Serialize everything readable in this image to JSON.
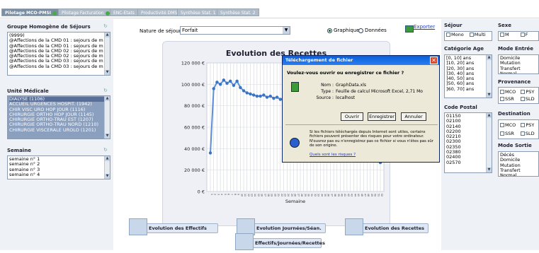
{
  "tabs": [
    {
      "label": "Pilotage MCO-PMSI",
      "active": true,
      "dot": true
    },
    {
      "label": "Pilotage Facturation",
      "active": false,
      "dot": true
    },
    {
      "label": "ENC-Etats",
      "active": false,
      "dot": false
    },
    {
      "label": "Productivité DMS",
      "active": false,
      "dot": false
    },
    {
      "label": "Synthèse Stat. 1",
      "active": false,
      "dot": false
    },
    {
      "label": "Synthèse Stat. 2",
      "active": false,
      "dot": false
    }
  ],
  "ghs": {
    "title": "Groupe Homogène de Séjours",
    "items": [
      "(9999)",
      "@Affections de la CMD 01 : sejours de m",
      "@Affections de la CMD 01 : sejours de m",
      "@Affections de la CMD 02 : sejours de m",
      "@Affections de la CMD 02 : sejours de m",
      "@Affections de la CMD 03 : sejours de m",
      "@Affections de la CMD 03 : sejours de m"
    ]
  },
  "unite": {
    "title": "Unité Médicale",
    "items": [
      "DIALYSE (1106)",
      "ACCUEIL URGENCES HOSPIT. (1942)",
      "CHIR VISC URO HOP JOUR (1116)",
      "CHIRURGIE ORTHO HOP JOUR (1145)",
      "CHIRURGIE ORTHO-TRAU EST (1207)",
      "CHIRURGIE ORTHO-TRAU NORD (1210)",
      "CHIRURGIE VISCERALE UROLO (1201)"
    ]
  },
  "semaine": {
    "title": "Semaine",
    "items": [
      "semaine n° 1",
      "semaine n° 2",
      "semaine n° 3",
      "semaine n° 4"
    ]
  },
  "controls": {
    "nature_label": "Nature de séjour :",
    "nature_value": "Forfait",
    "radio_graph": "Graphique",
    "radio_data": "Données",
    "export": "Exporter"
  },
  "chart_data": {
    "type": "line",
    "title": "Evolution des Recettes",
    "xlabel": "Semaine",
    "ylabel": "",
    "ylim": [
      0,
      120000
    ],
    "ytick_labels": [
      "0 €",
      "20 000 €",
      "40 000 €",
      "60 000 €",
      "80 000 €",
      "100 000 €",
      "120 000 €"
    ],
    "x": [
      1,
      2,
      3,
      4,
      5,
      6,
      7,
      8,
      9,
      10,
      11,
      12,
      13,
      14,
      15,
      16,
      17,
      18,
      19,
      20,
      21,
      22,
      23,
      24,
      25,
      26,
      27,
      28,
      29,
      30,
      31,
      32,
      33,
      34,
      35,
      36,
      37,
      38,
      39,
      40,
      41,
      42,
      43,
      44,
      45,
      46,
      47,
      48,
      49,
      50,
      51,
      52
    ],
    "series": [
      {
        "values": [
          36000,
          96000,
          102000,
          100000,
          104000,
          101000,
          103000,
          99000,
          103000,
          97000,
          94000,
          92000,
          91000,
          90000,
          89000,
          89000,
          90000,
          88000,
          89000,
          87000,
          88000,
          86000,
          87000,
          85000,
          86000,
          84000,
          85000,
          84000,
          83000,
          84000,
          85000,
          83000,
          84000,
          82000,
          83000,
          84000,
          85000,
          86000,
          88000,
          90000,
          91000,
          92000,
          93000,
          94000,
          95000,
          93000,
          95000,
          96000,
          94000,
          90000,
          60000,
          27000
        ]
      }
    ],
    "grid": true
  },
  "dialog": {
    "title": "Téléchargement de fichier",
    "question": "Voulez-vous ouvrir ou enregistrer ce fichier ?",
    "name_label": "Nom :",
    "name_value": "GraphData.xls",
    "type_label": "Type :",
    "type_value": "Feuille de calcul Microsoft Excel, 2,71 Mo",
    "source_label": "Source :",
    "source_value": "localhost",
    "open": "Ouvrir",
    "save": "Enregistrer",
    "cancel": "Annuler",
    "warning": "Si les fichiers téléchargés depuis Internet sont utiles, certains fichiers peuvent présenter des risques pour votre ordinateur. N'ouvrez pas ou n'enregistrez pas ce fichier si vous n'êtes pas sûr de son origine.",
    "link": "Quels sont les risques ?"
  },
  "buttons": {
    "effectifs": "Evolution des Effectifs",
    "journees": "Evolution Journées/Séan.",
    "recettes": "Evolution des Recettes",
    "combined": "Effectifs/Journées/Recettes"
  },
  "right": {
    "sejour_title": "Séjour",
    "mono": "Mono",
    "multi": "Multi",
    "sexe_title": "Sexe",
    "sexe_m": "M",
    "sexe_f": "F",
    "age_title": "Catégorie Age",
    "age_items": [
      "[0, 10] ans",
      "]10, 20] ans",
      "]20, 30] ans",
      "]30, 40] ans",
      "]40, 50] ans",
      "]50, 60] ans",
      "]60, 70] ans"
    ],
    "mode_entree_title": "Mode Entrée",
    "mode_entree_items": [
      "Domicile",
      "Mutation",
      "Transfert Normal"
    ],
    "provenance_title": "Provenance",
    "prov_mco": "MCO",
    "prov_ps": "PSY",
    "prov_ssr": "SSR",
    "prov_sld": "SLD",
    "cp_title": "Code Postal",
    "cp_items": [
      "01150",
      "02100",
      "02140",
      "02200",
      "02210",
      "02300",
      "02350",
      "02380",
      "02400",
      "02570"
    ],
    "destination_title": "Destination",
    "dest_mco": "MCO",
    "dest_ps": "PSY",
    "dest_ssr": "SSR",
    "dest_sld": "SLD",
    "mode_sortie_title": "Mode Sortie",
    "mode_sortie_items": [
      "Décès",
      "Domicile",
      "Mutation",
      "Transfert Normal"
    ]
  }
}
